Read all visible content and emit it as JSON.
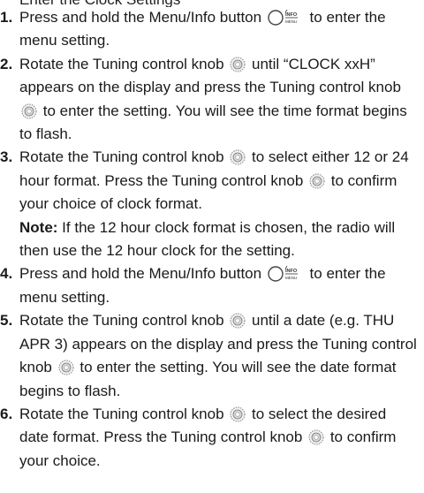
{
  "top_fragment": "Enter the Clock Settings",
  "steps": [
    {
      "number": "1.",
      "parts": [
        "Press and hold the Menu/Info button",
        "to enter the menu setting."
      ]
    },
    {
      "number": "2.",
      "parts": [
        "Rotate the Tuning control knob",
        "until “CLOCK xxH” appears on the display and press the Tuning control knob",
        "to enter the setting. You will see the time format begins to flash."
      ]
    },
    {
      "number": "3.",
      "parts": [
        "Rotate the Tuning control knob",
        "to select either 12 or 24 hour format. Press the Tuning control knob",
        "to confirm your choice of clock format."
      ],
      "note_label": "Note:",
      "note_text": " If the 12 hour clock format is chosen, the radio will then use the 12 hour clock for the setting."
    },
    {
      "number": "4.",
      "parts": [
        "Press and hold the Menu/Info button",
        "to enter the menu setting."
      ]
    },
    {
      "number": "5.",
      "parts": [
        "Rotate the Tuning control knob",
        "until a date (e.g. THU APR 3) appears on the display and press the Tuning control knob",
        "to enter the setting. You will see the date format begins to flash."
      ]
    },
    {
      "number": "6.",
      "parts": [
        "Rotate the Tuning control knob",
        "to select the desired date format. Press the Tuning control knob",
        "to confirm your choice."
      ]
    }
  ],
  "icons": {
    "menu_info": "menu-info-button-icon",
    "knob": "tuning-knob-icon",
    "menu_info_top_text": "INFO",
    "menu_info_bottom_text": "MENU"
  }
}
